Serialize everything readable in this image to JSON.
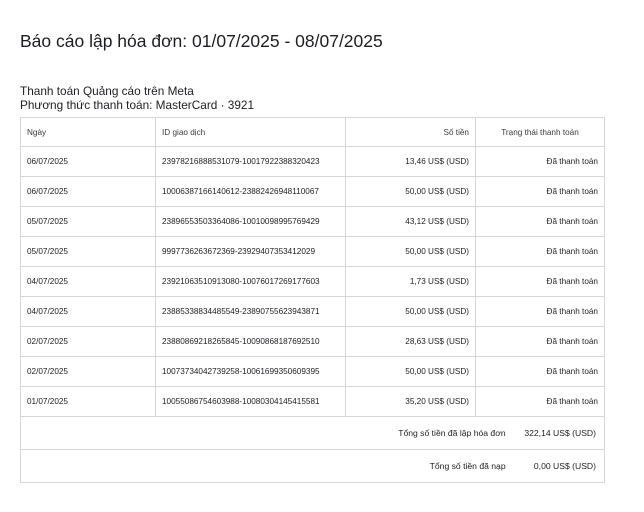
{
  "title": "Báo cáo lập hóa đơn: 01/07/2025 - 08/07/2025",
  "section": {
    "heading": "Thanh toán Quảng cáo trên Meta",
    "payment_method": "Phương thức thanh toán: MasterCard · 3921"
  },
  "table": {
    "headers": {
      "date": "Ngày",
      "id": "ID giao dịch",
      "amount": "Số tiền",
      "status": "Trạng thái thanh toán"
    },
    "rows": [
      {
        "date": "06/07/2025",
        "id": "23978216888531079-10017922388320423",
        "amount": "13,46 US$ (USD)",
        "status": "Đã thanh toán"
      },
      {
        "date": "06/07/2025",
        "id": "10006387166140612-23882426948110067",
        "amount": "50,00 US$ (USD)",
        "status": "Đã thanh toán"
      },
      {
        "date": "05/07/2025",
        "id": "23896553503364086-10010098995769429",
        "amount": "43,12 US$ (USD)",
        "status": "Đã thanh toán"
      },
      {
        "date": "05/07/2025",
        "id": "9997736263672369-23929407353412029",
        "amount": "50,00 US$ (USD)",
        "status": "Đã thanh toán"
      },
      {
        "date": "04/07/2025",
        "id": "23921063510913080-10076017269177603",
        "amount": "1,73 US$ (USD)",
        "status": "Đã thanh toán"
      },
      {
        "date": "04/07/2025",
        "id": "23885338834485549-23890755623943871",
        "amount": "50,00 US$ (USD)",
        "status": "Đã thanh toán"
      },
      {
        "date": "02/07/2025",
        "id": "23880869218265845-10090868187692510",
        "amount": "28,63 US$ (USD)",
        "status": "Đã thanh toán"
      },
      {
        "date": "02/07/2025",
        "id": "10073734042739258-10061699350609395",
        "amount": "50,00 US$ (USD)",
        "status": "Đã thanh toán"
      },
      {
        "date": "01/07/2025",
        "id": "10055086754603988-10080304145415581",
        "amount": "35,20 US$ (USD)",
        "status": "Đã thanh toán"
      }
    ]
  },
  "totals": {
    "invoiced_label": "Tổng số tiền đã lập hóa đơn",
    "invoiced_value": "322,14 US$ (USD)",
    "deposited_label": "Tổng số tiền đã nạp",
    "deposited_value": "0,00 US$ (USD)"
  }
}
